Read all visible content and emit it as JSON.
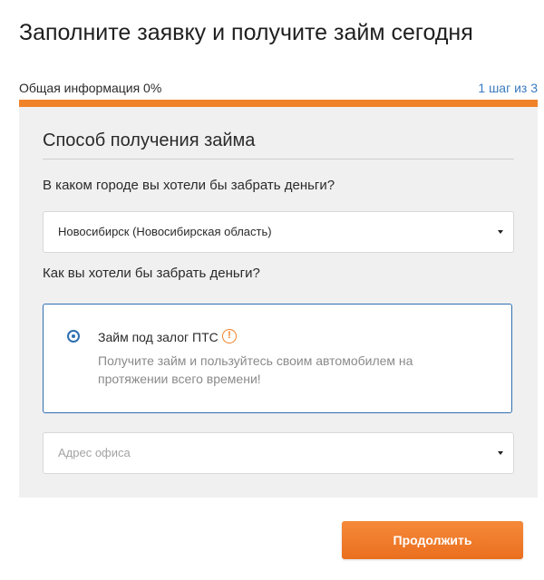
{
  "page": {
    "title": "Заполните заявку и получите займ сегодня"
  },
  "progress": {
    "label": "Общая информация 0%",
    "step_text": "1 шаг из 3",
    "percent": 0,
    "bar_color": "#f0822a"
  },
  "form": {
    "section_title": "Способ получения займа",
    "city_question": "В каком городе вы хотели бы забрать деньги?",
    "city_value": "Новосибирск (Новосибирская область)",
    "method_question": "Как вы хотели бы забрать деньги?",
    "option": {
      "title": "Займ под залог ПТС",
      "description": "Получите займ и пользуйтесь своим автомобилем на протяжении всего времени!",
      "selected": true,
      "info_icon": "!"
    },
    "office_placeholder": "Адрес офиса"
  },
  "actions": {
    "continue_label": "Продолжить",
    "accent_color": "#f0822a",
    "link_color": "#3a7bbf"
  }
}
